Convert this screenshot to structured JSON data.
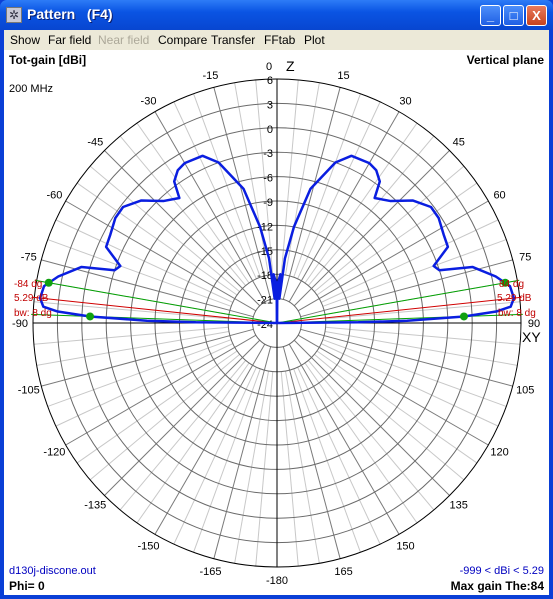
{
  "window": {
    "title": "Pattern   (F4)",
    "minimize": "_",
    "maximize": "□",
    "close": "X"
  },
  "menu": [
    {
      "label": "Show",
      "enabled": true
    },
    {
      "label": "Far field",
      "enabled": true
    },
    {
      "label": "Near field",
      "enabled": false
    },
    {
      "label": "Compare",
      "enabled": true
    },
    {
      "label": "Transfer",
      "enabled": true
    },
    {
      "label": "FFtab",
      "enabled": true
    },
    {
      "label": "Plot",
      "enabled": true
    }
  ],
  "plot": {
    "gain_label": "Tot-gain [dBi]",
    "plane_label": "Vertical plane",
    "frequency": "200 MHz",
    "z_axis": "Z",
    "xy_axis": "XY",
    "file": "d130j-discone.out",
    "phi": "Phi= 0",
    "range": "-999 < dBi < 5.29",
    "max_gain": "Max gain The:84",
    "left_marker": {
      "angle": "-84 dg",
      "gain": "5.29 dB",
      "bw": "bw: 8 dg"
    },
    "right_marker": {
      "angle": "84 dg",
      "gain": "5.29 dB",
      "bw": "bw: 8 dg"
    },
    "colors": {
      "pattern": "#0a1ee0",
      "max_line": "#d00000",
      "bw_line": "#00a000",
      "grid": "#808080"
    }
  },
  "chart_data": {
    "type": "polar",
    "r_ticks": [
      "6",
      "3",
      "0",
      "-3",
      "-6",
      "-9",
      "-12",
      "-15",
      "-18",
      "-21",
      "-24"
    ],
    "r_range": [
      -24,
      6
    ],
    "angle_ticks": [
      "0",
      "15",
      "30",
      "45",
      "60",
      "75",
      "90",
      "105",
      "120",
      "135",
      "150",
      "165",
      "-180",
      "-165",
      "-150",
      "-135",
      "-120",
      "-105",
      "-90",
      "-75",
      "-60",
      "-45",
      "-30",
      "-15"
    ],
    "max_gain_dbi": 5.29,
    "max_gain_theta": 84,
    "beamwidth_deg": 8,
    "series": [
      {
        "theta_deg": [
          0,
          0.6,
          1.5,
          4,
          5,
          5.5,
          7,
          10,
          14,
          20,
          24,
          30,
          33,
          36,
          38,
          43,
          48,
          53,
          57,
          62,
          66,
          70,
          72,
          74,
          78,
          81,
          84,
          86,
          87,
          88,
          89,
          89.5,
          90
        ],
        "gain_dbi": [
          -24,
          -21,
          -19,
          -18,
          -18.5,
          -21,
          -16,
          -12,
          -7,
          -3,
          -1.5,
          -1.3,
          -1.6,
          -2.5,
          -4.5,
          -3.5,
          -1.5,
          -0.3,
          -0.3,
          -0.8,
          -1.0,
          -3.5,
          -3,
          1.0,
          3.5,
          5.0,
          5.29,
          4.8,
          3.0,
          -1,
          -8,
          -14,
          -24
        ]
      }
    ]
  }
}
